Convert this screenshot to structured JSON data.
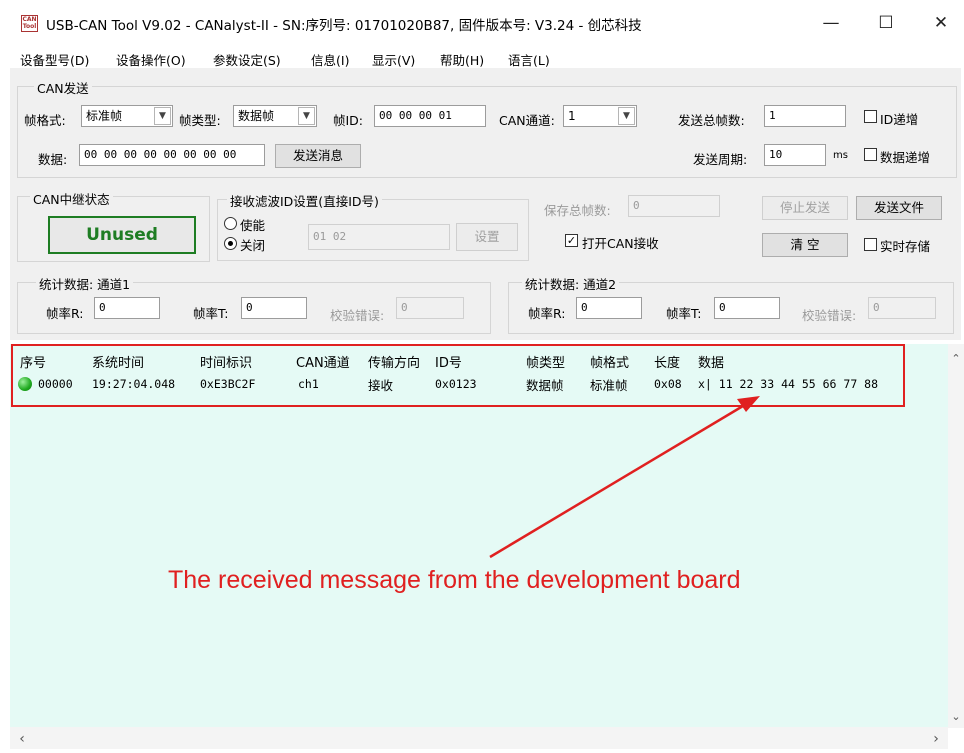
{
  "window": {
    "icon_text": "CAN Tool",
    "title": "USB-CAN Tool V9.02 - CANalyst-II - SN:序列号: 01701020B87, 固件版本号: V3.24 - 创芯科技",
    "controls": {
      "minimize": "—",
      "maximize": "☐",
      "close": "✕"
    }
  },
  "menu": [
    "设备型号(D)",
    "设备操作(O)",
    "参数设定(S)",
    "信息(I)",
    "显示(V)",
    "帮助(H)",
    "语言(L)"
  ],
  "send": {
    "legend": "CAN发送",
    "frame_format_label": "帧格式:",
    "frame_format_value": "标准帧",
    "frame_type_label": "帧类型:",
    "frame_type_value": "数据帧",
    "frame_id_label": "帧ID:",
    "frame_id_value": "00 00 00 01",
    "channel_label": "CAN通道:",
    "channel_value": "1",
    "total_frames_label": "发送总帧数:",
    "total_frames_value": "1",
    "id_increment_label": "ID递增",
    "data_label": "数据:",
    "data_value": "00 00 00 00 00 00 00 00",
    "send_button": "发送消息",
    "period_label": "发送周期:",
    "period_value": "10",
    "period_unit": "ms",
    "data_increment_label": "数据递增"
  },
  "relay": {
    "legend": "CAN中继状态",
    "status": "Unused"
  },
  "filter": {
    "legend": "接收滤波ID设置(直接ID号)",
    "enable_label": "使能",
    "close_label": "关闭",
    "ids_value": "01 02",
    "set_button": "设置"
  },
  "save": {
    "total_saved_label": "保存总帧数:",
    "total_saved_value": "0",
    "open_receive_label": "打开CAN接收",
    "stop_send_button": "停止发送",
    "send_file_button": "发送文件",
    "clear_button": "清 空",
    "realtime_save_label": "实时存储"
  },
  "stats1": {
    "legend": "统计数据: 通道1",
    "rate_r_label": "帧率R:",
    "rate_r_value": "0",
    "rate_t_label": "帧率T:",
    "rate_t_value": "0",
    "check_err_label": "校验错误:",
    "check_err_value": "0"
  },
  "stats2": {
    "legend": "统计数据: 通道2",
    "rate_r_label": "帧率R:",
    "rate_r_value": "0",
    "rate_t_label": "帧率T:",
    "rate_t_value": "0",
    "check_err_label": "校验错误:",
    "check_err_value": "0"
  },
  "list": {
    "columns": [
      "序号",
      "系统时间",
      "时间标识",
      "CAN通道",
      "传输方向",
      "ID号",
      "帧类型",
      "帧格式",
      "长度",
      "数据"
    ],
    "rows": [
      {
        "index": "00000",
        "system_time": "19:27:04.048",
        "timestamp": "0xE3BC2F",
        "channel": "ch1",
        "direction": "接收",
        "id": "0x0123",
        "frame_type": "数据帧",
        "frame_format": "标准帧",
        "length": "0x08",
        "data": "x| 11 22 33 44 55 66 77 88"
      }
    ]
  },
  "annotation": "The received message from the development board",
  "colors": {
    "highlight": "#e02020",
    "list_bg": "#e5faf5",
    "status_green": "#1e7d23"
  }
}
